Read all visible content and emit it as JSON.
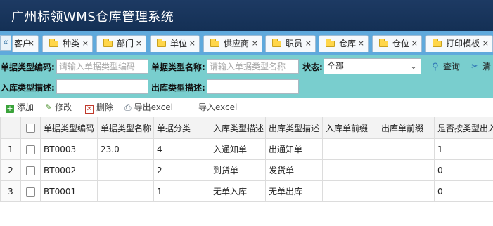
{
  "app": {
    "title": "广州标领WMS仓库管理系统"
  },
  "tabs": [
    {
      "label": "客户",
      "icon": "folder-icon"
    },
    {
      "label": "种类",
      "icon": "folder-icon"
    },
    {
      "label": "部门",
      "icon": "folder-icon"
    },
    {
      "label": "单位",
      "icon": "folder-icon"
    },
    {
      "label": "供应商",
      "icon": "folder-icon"
    },
    {
      "label": "职员",
      "icon": "folder-icon"
    },
    {
      "label": "仓库",
      "icon": "folder-icon"
    },
    {
      "label": "仓位",
      "icon": "folder-icon"
    },
    {
      "label": "打印模板",
      "icon": "folder-icon"
    }
  ],
  "tab_close": "×",
  "tab_scroll_left": "«",
  "filters": {
    "code_label": "单据类型编码:",
    "code_placeholder": "请输入单据类型编码",
    "name_label": "单据类型名称:",
    "name_placeholder": "请输入单据类型名称",
    "status_label": "状态:",
    "status_value": "全部",
    "query_label": "查询",
    "clear_label": "清",
    "in_desc_label": "入库类型描述:",
    "out_desc_label": "出库类型描述:"
  },
  "toolbar": {
    "add": "添加",
    "edit": "修改",
    "delete": "删除",
    "export": "导出excel",
    "import": "导入excel"
  },
  "table": {
    "columns": [
      "单据类型编码",
      "单据类型名称",
      "单据分类",
      "入库类型描述",
      "出库类型描述",
      "入库单前缀",
      "出库单前缀",
      "是否按类型出入"
    ],
    "rows": [
      {
        "n": "1",
        "cells": [
          "BT0003",
          "23.0",
          "4",
          "入通知单",
          "出通知单",
          "",
          "",
          "1"
        ]
      },
      {
        "n": "2",
        "cells": [
          "BT0002",
          "",
          "2",
          "到货单",
          "发货单",
          "",
          "",
          "0"
        ]
      },
      {
        "n": "3",
        "cells": [
          "BT0001",
          "",
          "1",
          "无单入库",
          "无单出库",
          "",
          "",
          "0"
        ]
      }
    ]
  },
  "colors": {
    "header_bg": "#1d3a63",
    "tabbar_bg": "#5fa9dc",
    "filter_bg": "#79cece"
  }
}
